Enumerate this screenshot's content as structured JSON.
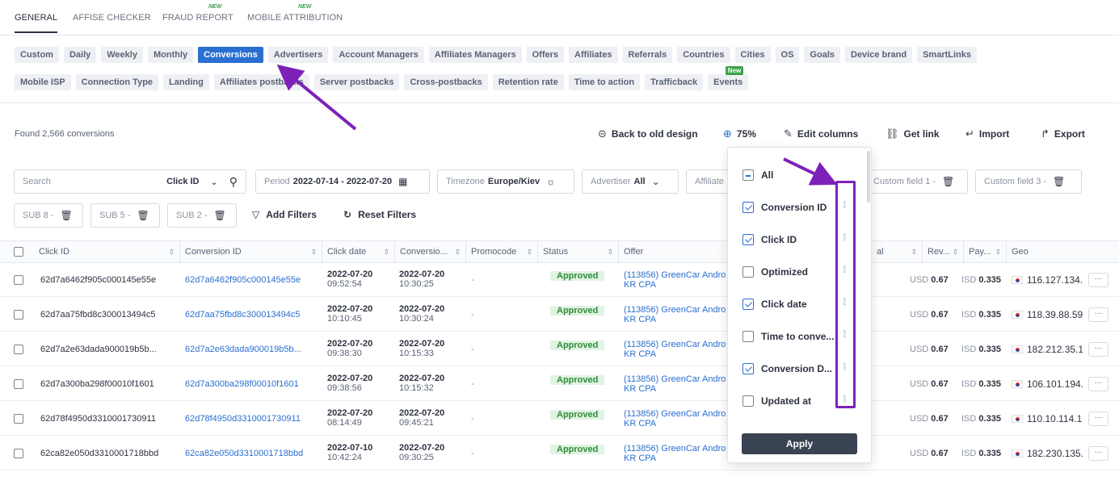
{
  "top_tabs": [
    {
      "label": "GENERAL",
      "active": true
    },
    {
      "label": "AFFISE CHECKER"
    },
    {
      "label": "FRAUD REPORT",
      "badge": "NEW"
    },
    {
      "label": "MOBILE ATTRIBUTION",
      "badge": "NEW"
    }
  ],
  "chips_row1": [
    "Custom",
    "Daily",
    "Weekly",
    "Monthly",
    "Conversions",
    "Advertisers",
    "Account Managers",
    "Affiliates Managers",
    "Offers",
    "Affiliates",
    "Referrals",
    "Countries",
    "Cities",
    "OS",
    "Goals",
    "Device brand",
    "SmartLinks"
  ],
  "chips_row2": [
    "Mobile ISP",
    "Connection Type",
    "Landing",
    "Affiliates postbacks",
    "Server postbacks",
    "Cross-postbacks",
    "Retention rate",
    "Time to action",
    "Trafficback",
    "Events"
  ],
  "chip_active": "Conversions",
  "events_badge": "New",
  "found_text": "Found 2,566 conversions",
  "actions": {
    "back": "Back to old design",
    "zoom": "75%",
    "edit_columns": "Edit columns",
    "get_link": "Get link",
    "import": "Import",
    "export": "Export"
  },
  "filters": {
    "search_placeholder": "Search",
    "search_field": "Click ID",
    "period_label": "Period",
    "period_value": "2022-07-14 - 2022-07-20",
    "timezone_label": "Timezone",
    "timezone_value": "Europe/Kiev",
    "advertiser_label": "Advertiser",
    "advertiser_value": "All",
    "affiliate_label": "Affiliate",
    "custom_field_1": "Custom field 1 -",
    "custom_field_3": "Custom field 3 -",
    "sub8": "SUB 8 -",
    "sub5": "SUB 5 -",
    "sub2": "SUB 2 -",
    "add_filters": "Add Filters",
    "reset_filters": "Reset Filters"
  },
  "columns": [
    "Click ID",
    "Conversion ID",
    "Click date",
    "Conversio...",
    "Promocode",
    "Status",
    "Offer",
    "al",
    "Rev...",
    "Pay...",
    "Geo"
  ],
  "rows": [
    {
      "click_id": "62d7a6462f905c000145e55e",
      "conv_id": "62d7a6462f905c000145e55e",
      "click_date": "2022-07-20",
      "click_time": "09:52:54",
      "conv_date": "2022-07-20",
      "conv_time": "10:30:25",
      "promo": "-",
      "status": "Approved",
      "offer1": "(113856) GreenCar Andro",
      "offer2": "KR CPA",
      "rev_cur": "USD",
      "rev": "0.67",
      "pay_cur": "ISD",
      "pay": "0.335",
      "ip": "116.127.134."
    },
    {
      "click_id": "62d7aa75fbd8c300013494c5",
      "conv_id": "62d7aa75fbd8c300013494c5",
      "click_date": "2022-07-20",
      "click_time": "10:10:45",
      "conv_date": "2022-07-20",
      "conv_time": "10:30:24",
      "promo": "-",
      "status": "Approved",
      "offer1": "(113856) GreenCar Andro",
      "offer2": "KR CPA",
      "rev_cur": "USD",
      "rev": "0.67",
      "pay_cur": "ISD",
      "pay": "0.335",
      "ip": "118.39.88.59"
    },
    {
      "click_id": "62d7a2e63dada900019b5b...",
      "conv_id": "62d7a2e63dada900019b5b...",
      "click_date": "2022-07-20",
      "click_time": "09:38:30",
      "conv_date": "2022-07-20",
      "conv_time": "10:15:33",
      "promo": "-",
      "status": "Approved",
      "offer1": "(113856) GreenCar Andro",
      "offer2": "KR CPA",
      "rev_cur": "USD",
      "rev": "0.67",
      "pay_cur": "ISD",
      "pay": "0.335",
      "ip": "182.212.35.1"
    },
    {
      "click_id": "62d7a300ba298f00010f1601",
      "conv_id": "62d7a300ba298f00010f1601",
      "click_date": "2022-07-20",
      "click_time": "09:38:56",
      "conv_date": "2022-07-20",
      "conv_time": "10:15:32",
      "promo": "-",
      "status": "Approved",
      "offer1": "(113856) GreenCar Andro",
      "offer2": "KR CPA",
      "rev_cur": "USD",
      "rev": "0.67",
      "pay_cur": "ISD",
      "pay": "0.335",
      "ip": "106.101.194."
    },
    {
      "click_id": "62d78f4950d3310001730911",
      "conv_id": "62d78f4950d3310001730911",
      "click_date": "2022-07-20",
      "click_time": "08:14:49",
      "conv_date": "2022-07-20",
      "conv_time": "09:45:21",
      "promo": "-",
      "status": "Approved",
      "offer1": "(113856) GreenCar Andro",
      "offer2": "KR CPA",
      "rev_cur": "USD",
      "rev": "0.67",
      "pay_cur": "ISD",
      "pay": "0.335",
      "ip": "110.10.114.1"
    },
    {
      "click_id": "62ca82e050d3310001718bbd",
      "conv_id": "62ca82e050d3310001718bbd",
      "click_date": "2022-07-10",
      "click_time": "10:42:24",
      "conv_date": "2022-07-20",
      "conv_time": "09:30:25",
      "promo": "-",
      "status": "Approved",
      "offer1": "(113856) GreenCar Andro",
      "offer2": "KR CPA",
      "rev_cur": "USD",
      "rev": "0.67",
      "pay_cur": "ISD",
      "pay": "0.335",
      "ip": "182.230.135."
    }
  ],
  "column_picker": {
    "items": [
      {
        "label": "All",
        "state": "partial"
      },
      {
        "label": "Conversion ID",
        "state": "checked"
      },
      {
        "label": "Click ID",
        "state": "checked"
      },
      {
        "label": "Optimized",
        "state": "unchecked"
      },
      {
        "label": "Click date",
        "state": "checked"
      },
      {
        "label": "Time to conve...",
        "state": "unchecked"
      },
      {
        "label": "Conversion D...",
        "state": "checked"
      },
      {
        "label": "Updated at",
        "state": "unchecked"
      }
    ],
    "apply": "Apply"
  },
  "colors": {
    "accent": "#2a6fd1",
    "annotation": "#7d22b8",
    "approved_bg": "#e1f3e2",
    "approved_text": "#2f8d3a",
    "new_badge": "#3ca24a"
  }
}
